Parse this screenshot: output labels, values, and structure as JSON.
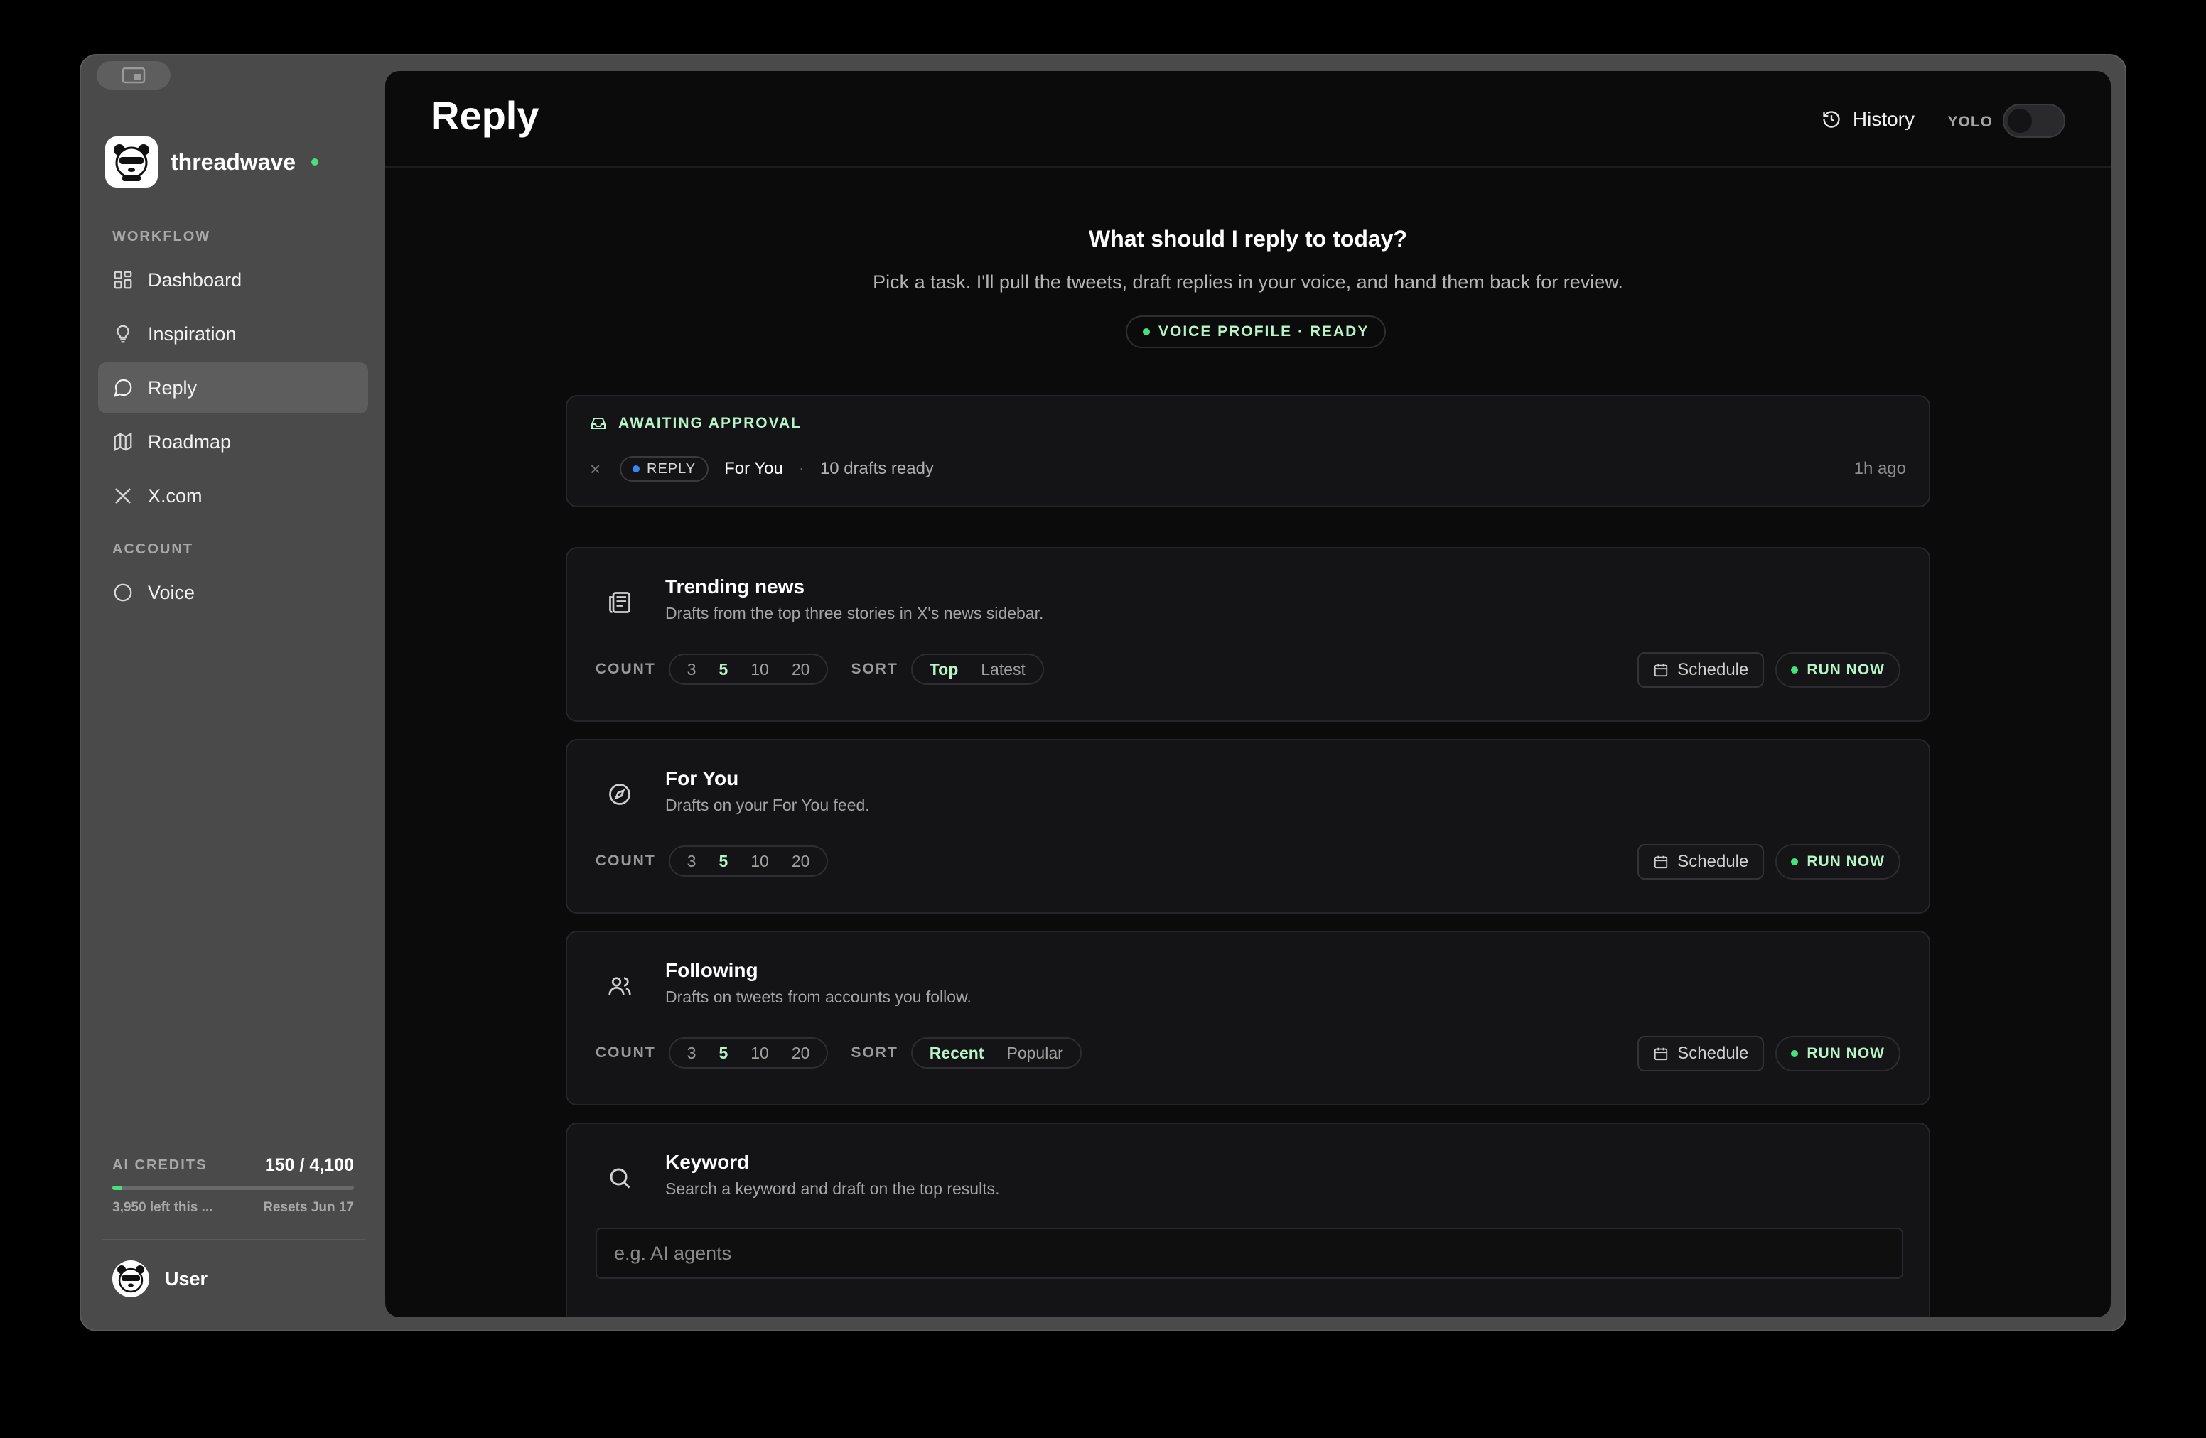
{
  "brand": {
    "name": "threadwave"
  },
  "sidebar": {
    "workflow_label": "WORKFLOW",
    "account_label": "ACCOUNT",
    "workflow_items": [
      {
        "label": "Dashboard",
        "icon": "dashboard-icon"
      },
      {
        "label": "Inspiration",
        "icon": "lightbulb-icon"
      },
      {
        "label": "Reply",
        "icon": "chat-bubble-icon",
        "active": true
      },
      {
        "label": "Roadmap",
        "icon": "map-icon"
      },
      {
        "label": "X.com",
        "icon": "x-logo-icon"
      }
    ],
    "account_items": [
      {
        "label": "Voice",
        "icon": "smiley-icon"
      }
    ]
  },
  "credits": {
    "label": "AI CREDITS",
    "value": "150 / 4,100",
    "used_fraction": 0.037,
    "left_text": "3,950 left this ...",
    "resets_text": "Resets Jun 17"
  },
  "user": {
    "name": "User"
  },
  "header": {
    "title": "Reply",
    "history_label": "History",
    "yolo_label": "YOLO",
    "yolo_on": false
  },
  "hero": {
    "title": "What should I reply to today?",
    "subtitle": "Pick a task. I'll pull the tweets, draft replies in your voice, and hand them back for review.",
    "badge": "VOICE PROFILE · READY"
  },
  "approval": {
    "title": "AWAITING APPROVAL",
    "close": "×",
    "badge": "REPLY",
    "feed": "For You",
    "separator": "·",
    "drafts": "10 drafts ready",
    "time": "1h ago"
  },
  "common": {
    "count_label": "COUNT",
    "sort_label": "SORT",
    "schedule_label": "Schedule",
    "run_label": "RUN NOW",
    "counts": [
      "3",
      "5",
      "10",
      "20"
    ]
  },
  "cards": [
    {
      "title": "Trending news",
      "desc": "Drafts from the top three stories in X's news sidebar.",
      "icon": "newspaper-icon",
      "selected_count": "5",
      "sort": [
        "Top",
        "Latest"
      ],
      "selected_sort": "Top"
    },
    {
      "title": "For You",
      "desc": "Drafts on your For You feed.",
      "icon": "compass-icon",
      "selected_count": "5"
    },
    {
      "title": "Following",
      "desc": "Drafts on tweets from accounts you follow.",
      "icon": "users-icon",
      "selected_count": "5",
      "sort": [
        "Recent",
        "Popular"
      ],
      "selected_sort": "Recent"
    },
    {
      "title": "Keyword",
      "desc": "Search a keyword and draft on the top results.",
      "icon": "search-icon",
      "input_placeholder": "e.g. AI agents"
    }
  ],
  "colors": {
    "accent": "#4ade80",
    "accent_text": "#b7f5c8",
    "reply_dot": "#3b82f6"
  }
}
